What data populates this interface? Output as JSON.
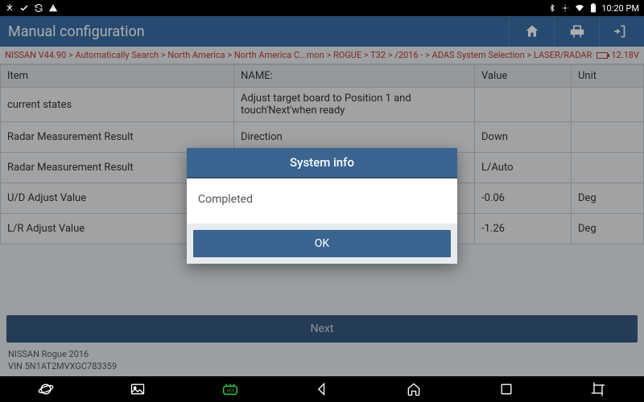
{
  "status": {
    "time": "10:20 PM"
  },
  "header": {
    "title": "Manual configuration"
  },
  "breadcrumb": {
    "text": "NISSAN V44.90 > Automatically Search > North America > North America C...mon > ROGUE > T32 > /2016 - > ADAS System Selection > LASER/RADAR",
    "voltage": "12.18V"
  },
  "columns": {
    "item": "Item",
    "name": "NAME:",
    "value": "Value",
    "unit": "Unit"
  },
  "rows": [
    {
      "item": "current states",
      "name": "Adjust target board to Position 1 and touch'Next'when ready",
      "value": "",
      "unit": ""
    },
    {
      "item": "Radar Measurement Result",
      "name": "Direction",
      "value": "Down",
      "unit": ""
    },
    {
      "item": "Radar Measurement Result",
      "name": "",
      "value": "L/Auto",
      "unit": ""
    },
    {
      "item": "U/D Adjust Value",
      "name": "",
      "value": "-0.06",
      "unit": "Deg"
    },
    {
      "item": "L/R Adjust Value",
      "name": "",
      "value": "-1.26",
      "unit": "Deg"
    }
  ],
  "next_label": "Next",
  "vehicle": {
    "line1": "NISSAN Rogue 2016",
    "line2": "VIN 5N1AT2MVXGC783359"
  },
  "dialog": {
    "title": "System info",
    "message": "Completed",
    "ok": "OK"
  }
}
